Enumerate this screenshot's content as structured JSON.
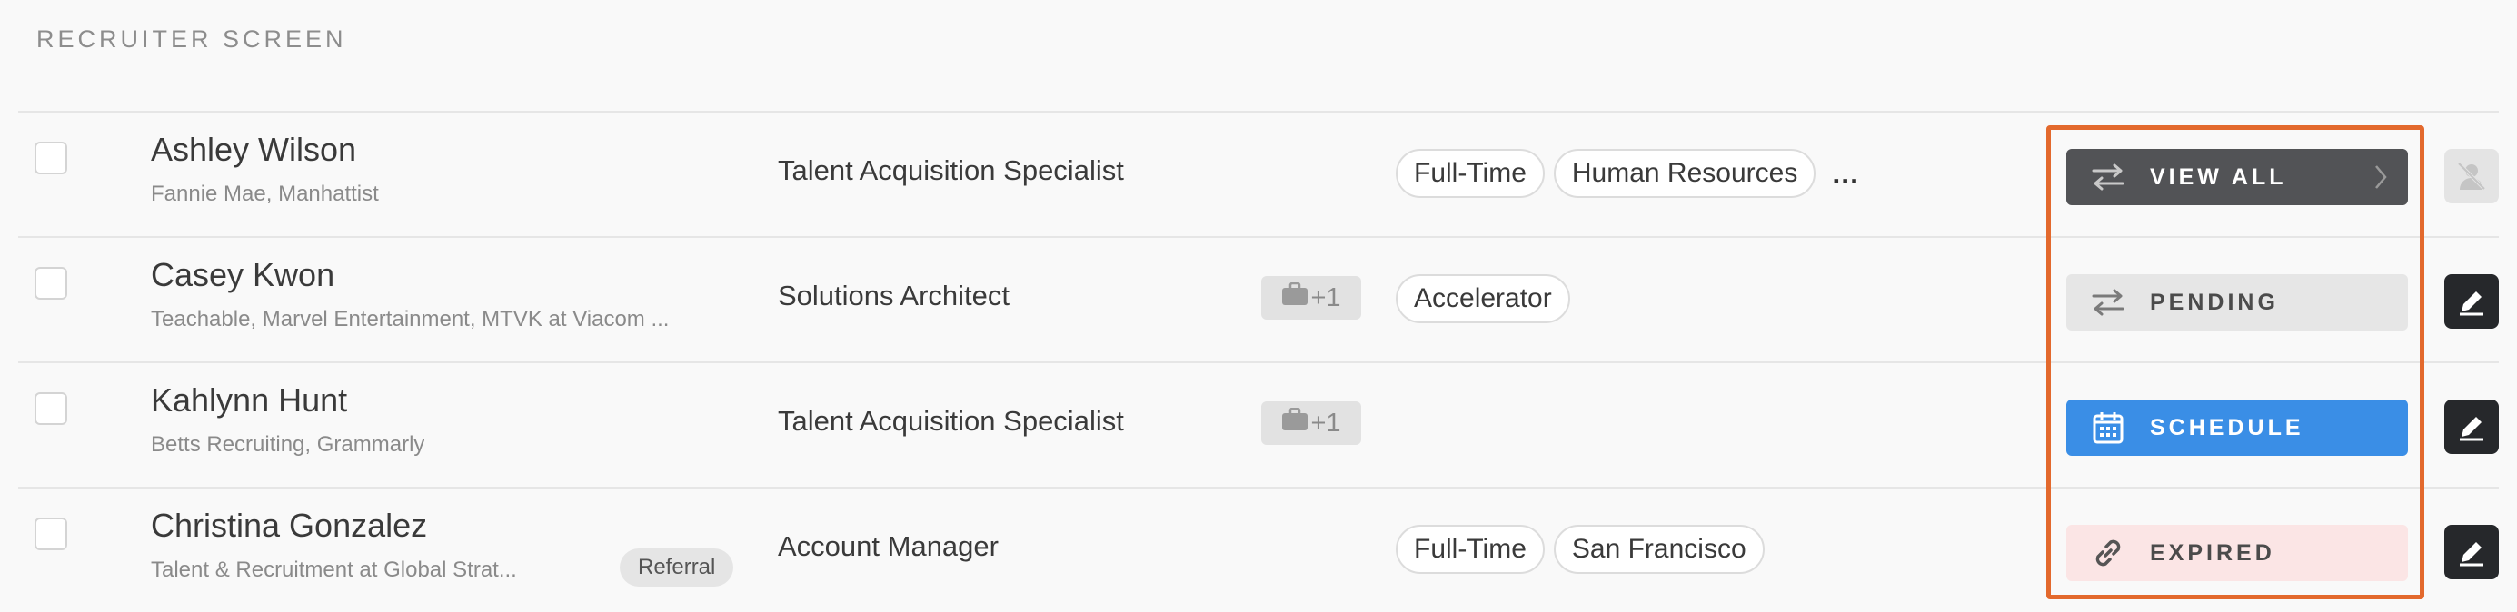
{
  "section": {
    "title": "RECRUITER SCREEN"
  },
  "colors": {
    "highlight": "#e3692d",
    "schedule": "#3a8ee6",
    "expired_bg": "#fbe5e5",
    "view_all_bg": "#525356"
  },
  "rows": [
    {
      "name": "Ashley Wilson",
      "company": "Fannie Mae, Manhattist",
      "role": "Talent Acquisition Specialist",
      "tags": [
        "Full-Time",
        "Human Resources"
      ],
      "more": "...",
      "action": {
        "label": "VIEW ALL",
        "icon": "swap-arrows-icon",
        "style": "dark"
      },
      "side_icon": "profile-disabled-icon"
    },
    {
      "name": "Casey Kwon",
      "company": "Teachable, Marvel Entertainment, MTVK at Viacom ...",
      "role": "Solutions Architect",
      "jobs_badge": "+1",
      "tags": [
        "Accelerator"
      ],
      "action": {
        "label": "PENDING",
        "icon": "swap-arrows-icon",
        "style": "gray"
      },
      "side_icon": "edit-icon"
    },
    {
      "name": "Kahlynn Hunt",
      "company": "Betts Recruiting, Grammarly",
      "role": "Talent Acquisition Specialist",
      "jobs_badge": "+1",
      "tags": [],
      "action": {
        "label": "SCHEDULE",
        "icon": "calendar-icon",
        "style": "blue"
      },
      "side_icon": "edit-icon"
    },
    {
      "name": "Christina Gonzalez",
      "company": "Talent & Recruitment at Global Strat...",
      "referral": "Referral",
      "role": "Account Manager",
      "tags": [
        "Full-Time",
        "San Francisco"
      ],
      "action": {
        "label": "EXPIRED",
        "icon": "link-icon",
        "style": "pink"
      },
      "side_icon": "edit-icon"
    }
  ]
}
